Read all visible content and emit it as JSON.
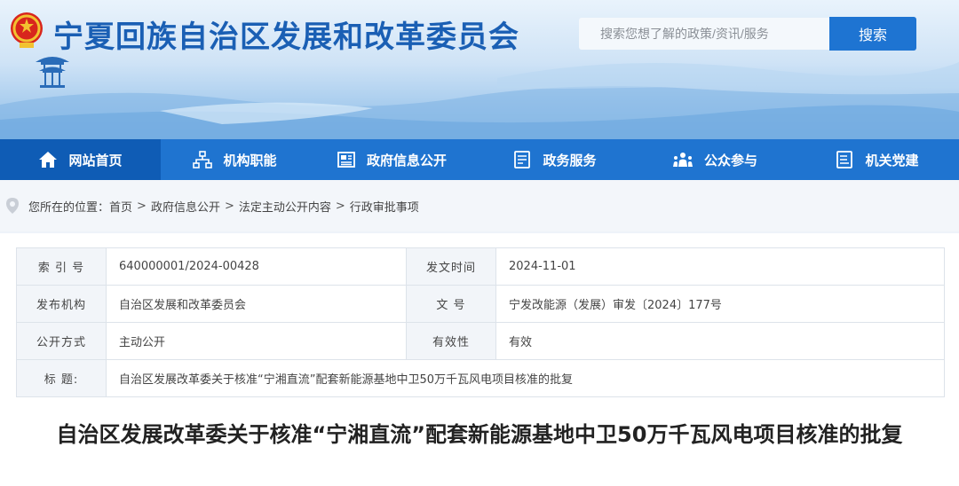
{
  "header": {
    "site_title": "宁夏回族自治区发展和改革委员会",
    "search_placeholder": "搜索您想了解的政策/资讯/服务",
    "search_button": "搜索"
  },
  "nav": {
    "items": [
      {
        "label": "网站首页",
        "icon": "home-icon",
        "active": true
      },
      {
        "label": "机构职能",
        "icon": "org-chart-icon",
        "active": false
      },
      {
        "label": "政府信息公开",
        "icon": "newspaper-icon",
        "active": false
      },
      {
        "label": "政务服务",
        "icon": "document-list-icon",
        "active": false
      },
      {
        "label": "公众参与",
        "icon": "people-icon",
        "active": false
      },
      {
        "label": "机关党建",
        "icon": "document-icon",
        "active": false
      }
    ],
    "colors": {
      "bar": "#1f74d0",
      "active": "#0f5cb5"
    }
  },
  "breadcrumb": {
    "prefix": "您所在的位置：",
    "items": [
      "首页",
      "政府信息公开",
      "法定主动公开内容",
      "行政审批事项"
    ],
    "separator": ">"
  },
  "meta_table": {
    "rows": [
      {
        "k1": "索 引 号",
        "v1": "640000001/2024-00428",
        "k2": "发文时间",
        "v2": "2024-11-01"
      },
      {
        "k1": "发布机构",
        "v1": "自治区发展和改革委员会",
        "k2": "文 号",
        "v2": "宁发改能源（发展）审发〔2024〕177号"
      },
      {
        "k1": "公开方式",
        "v1": "主动公开",
        "k2": "有效性",
        "v2": "有效"
      }
    ],
    "title_row": {
      "k": "标 题:",
      "v": "自治区发展改革委关于核准“宁湘直流”配套新能源基地中卫50万千瓦风电项目核准的批复"
    }
  },
  "document": {
    "title": "自治区发展改革委关于核准“宁湘直流”配套新能源基地中卫50万千瓦风电项目核准的批复"
  }
}
